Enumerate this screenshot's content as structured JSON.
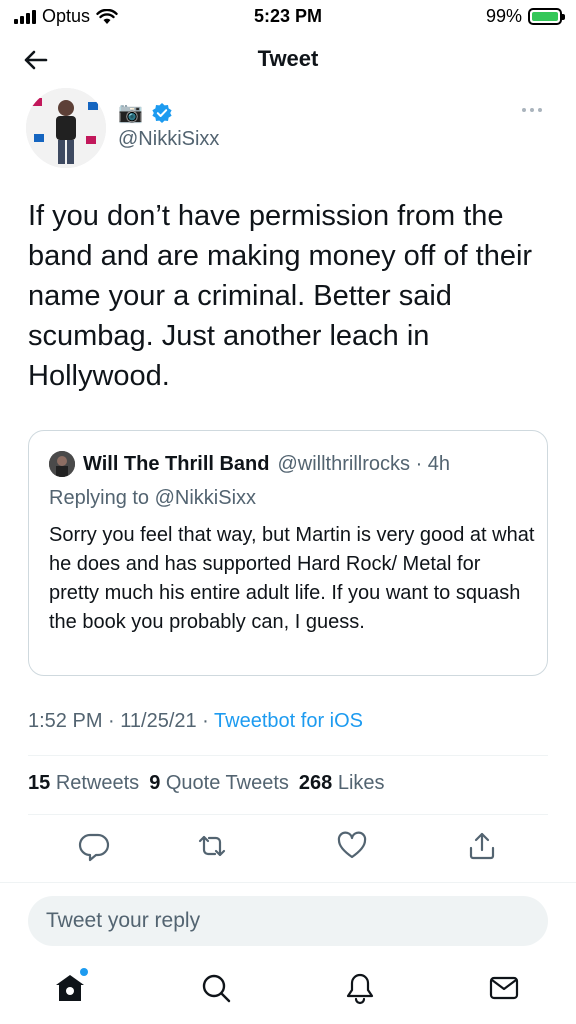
{
  "status_bar": {
    "carrier": "Optus",
    "time": "5:23 PM",
    "battery": "99%"
  },
  "header": {
    "title": "Tweet"
  },
  "tweet": {
    "author_emoji": "📷",
    "handle": "@NikkiSixx",
    "text": "If you don’t have permission from the band and are making money off of their name your a criminal.  Better said scumbag. Just another leach in Hollywood.",
    "timestamp": "1:52 PM · 11/25/21 · ",
    "client": "Tweetbot for iOS"
  },
  "quoted_tweet": {
    "name": "Will The Thrill Band",
    "meta": "@willthrillrocks · 4h",
    "replying_to": "Replying to @NikkiSixx",
    "text": "Sorry you feel that way, but Martin is very good at what he does and has supported Hard Rock/ Metal for pretty much his entire adult life. If you want to squash the book you probably can, I guess."
  },
  "stats": {
    "retweets_count": "15",
    "retweets_label": "Retweets",
    "quotes_count": "9",
    "quotes_label": "Quote Tweets",
    "likes_count": "268",
    "likes_label": "Likes"
  },
  "reply": {
    "placeholder": "Tweet your reply"
  },
  "icons": {
    "back": "arrow-left-icon",
    "verified": "verified-badge-icon",
    "more": "more-horizontal-icon",
    "reply": "reply-icon",
    "retweet": "retweet-icon",
    "like": "heart-icon",
    "share": "share-icon",
    "home": "home-icon",
    "search": "search-icon",
    "notifications": "bell-icon",
    "messages": "mail-icon"
  },
  "colors": {
    "accent": "#1d9bf0",
    "text": "#0f1419",
    "muted": "#536471"
  }
}
